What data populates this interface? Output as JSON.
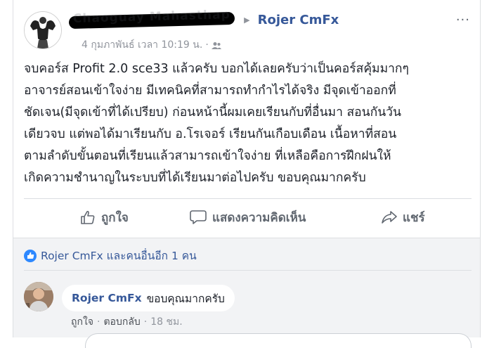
{
  "post": {
    "author_redacted": "Chaoguay Mahasthap",
    "page_name": "Rojer CmFx",
    "timestamp": "4 กุมภาพันธ์ เวลา 10:19 น.",
    "dot": "·",
    "more_label": "···",
    "text_lines": [
      "จบคอร์ส Profit 2.0 sce33 แล้วครับ บอกได้เลยครับว่าเป็นคอร์สคุ้มมากๆ",
      "อาจารย์สอนเข้าใจง่าย มีเทคนิคที่สามารถทำกำไรได้จริง มีจุดเข้าออกที่",
      "ชัดเจน(มีจุดเข้าที่ได้เปรียบ) ก่อนหน้านี้ผมเคยเรียนกับที่อื่นมา สอนกันวัน",
      "เดียวจบ แต่พอได้มาเรียนกับ อ.โรเจอร์ เรียนกันเกือบเดือน เนื้อหาที่สอน",
      "ตามลำดับขั้นตอนที่เรียนแล้วสามารถเข้าใจง่าย ที่เหลือคือการฝึกฝนให้",
      "เกิดความชำนาญในระบบที่ได้เรียนมาต่อไปครับ ขอบคุณมากครับ"
    ]
  },
  "actions": {
    "like": "ถูกใจ",
    "comment": "แสดงความคิดเห็น",
    "share": "แชร์"
  },
  "reactions": {
    "summary": "Rojer CmFx และคนอื่นอีก 1 คน"
  },
  "comment": {
    "author": "Rojer CmFx",
    "text": "ขอบคุณมากครับ",
    "like": "ถูกใจ",
    "reply": "ตอบกลับ",
    "age": "18 ชม.",
    "sep": "·"
  },
  "colors": {
    "link": "#365899",
    "muted": "#90949c",
    "like_badge": "#2d88ff"
  }
}
